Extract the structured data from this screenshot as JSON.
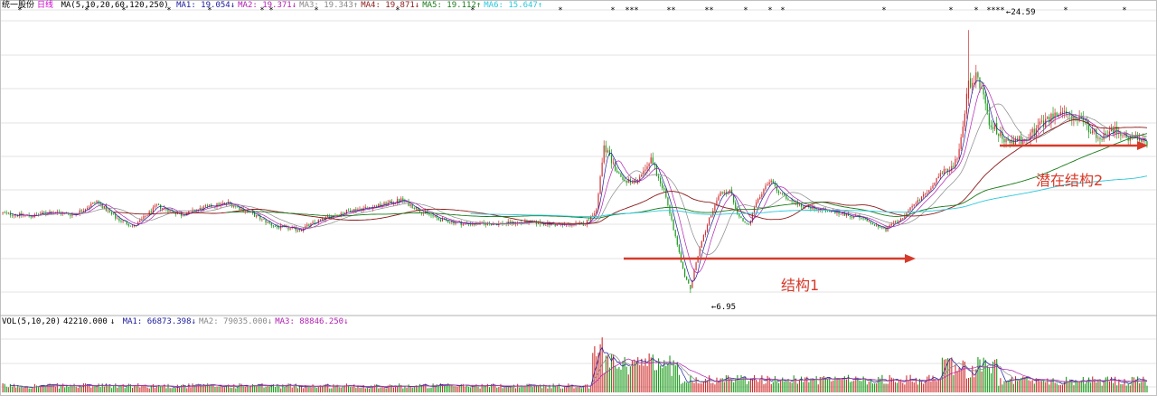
{
  "price_header": {
    "stock_name": "统一股份",
    "period": "日线",
    "ma_label": "MA(5,10,20,60,120,250)",
    "ma_values": [
      {
        "label": "MA1:",
        "value": "19.054",
        "arrow": "↓",
        "color": "#1a1a9c"
      },
      {
        "label": "MA2:",
        "value": "19.371",
        "arrow": "↓",
        "color": "#b020b0"
      },
      {
        "label": "MA3:",
        "value": "19.343",
        "arrow": "↑",
        "color": "#888888"
      },
      {
        "label": "MA4:",
        "value": "19.871",
        "arrow": "↓",
        "color": "#8b1a1a"
      },
      {
        "label": "MA5:",
        "value": "19.112",
        "arrow": "↑",
        "color": "#1a7a1a"
      },
      {
        "label": "MA6:",
        "value": "15.647",
        "arrow": "↑",
        "color": "#2ac8dc"
      }
    ]
  },
  "volume_header": {
    "vol_label": "VOL(5,10,20)",
    "vol_value": "42210.000",
    "vol_arrow": "↓",
    "ma_values": [
      {
        "label": "MA1:",
        "value": "66873.398",
        "arrow": "↓",
        "color": "#1a1a9c"
      },
      {
        "label": "MA2:",
        "value": "79035.000",
        "arrow": "↓",
        "color": "#888888"
      },
      {
        "label": "MA3:",
        "value": "88846.250",
        "arrow": "↓",
        "color": "#b020b0"
      }
    ]
  },
  "annotations": {
    "high_label": "24.59",
    "low_label": "6.95",
    "structure1": "结构1",
    "structure2": "潜在结构2"
  },
  "colors": {
    "up": "#d03030",
    "down": "#1a9a1a",
    "arrow": "#d63a2a",
    "grid": "#e3e3e3",
    "ma1": "#1a1a9c",
    "ma2": "#b020b0",
    "ma3": "#888888",
    "ma4": "#8b1a1a",
    "ma5": "#1a7a1a",
    "ma6": "#2ac8dc"
  },
  "chart_data": {
    "type": "candlestick",
    "ylim": [
      5.5,
      26.0
    ],
    "high": 24.59,
    "low": 6.95,
    "price_path_keypoints": [
      [
        0,
        12.3
      ],
      [
        15,
        12.1
      ],
      [
        25,
        12.4
      ],
      [
        38,
        12.2
      ],
      [
        50,
        13.1
      ],
      [
        60,
        12.0
      ],
      [
        70,
        11.4
      ],
      [
        82,
        12.8
      ],
      [
        95,
        12.2
      ],
      [
        108,
        12.7
      ],
      [
        120,
        13.0
      ],
      [
        132,
        12.3
      ],
      [
        145,
        11.4
      ],
      [
        158,
        11.2
      ],
      [
        170,
        11.9
      ],
      [
        185,
        12.5
      ],
      [
        200,
        12.8
      ],
      [
        212,
        13.2
      ],
      [
        222,
        12.5
      ],
      [
        232,
        11.9
      ],
      [
        245,
        11.6
      ],
      [
        262,
        11.6
      ],
      [
        280,
        11.7
      ],
      [
        298,
        11.5
      ],
      [
        310,
        11.6
      ],
      [
        316,
        12.6
      ],
      [
        320,
        17.0
      ],
      [
        323,
        16.0
      ],
      [
        330,
        14.5
      ],
      [
        338,
        14.4
      ],
      [
        345,
        16.0
      ],
      [
        352,
        13.8
      ],
      [
        358,
        10.8
      ],
      [
        363,
        8.0
      ],
      [
        366,
        7.3
      ],
      [
        370,
        9.5
      ],
      [
        376,
        12.0
      ],
      [
        382,
        13.6
      ],
      [
        387,
        13.8
      ],
      [
        392,
        12.0
      ],
      [
        397,
        11.5
      ],
      [
        402,
        13.3
      ],
      [
        408,
        14.5
      ],
      [
        415,
        13.5
      ],
      [
        425,
        12.8
      ],
      [
        438,
        12.5
      ],
      [
        450,
        12.2
      ],
      [
        460,
        11.8
      ],
      [
        470,
        11.2
      ],
      [
        480,
        12.2
      ],
      [
        490,
        13.5
      ],
      [
        500,
        15.0
      ],
      [
        508,
        15.8
      ],
      [
        514,
        21.0
      ],
      [
        519,
        21.5
      ],
      [
        525,
        18.5
      ],
      [
        535,
        17.0
      ],
      [
        545,
        17.3
      ],
      [
        555,
        18.5
      ],
      [
        562,
        19.0
      ],
      [
        570,
        18.8
      ],
      [
        578,
        18.0
      ],
      [
        585,
        17.3
      ],
      [
        592,
        18.0
      ],
      [
        600,
        17.2
      ],
      [
        610,
        17.0
      ]
    ],
    "volume_level": "low before the breakout, spike to the highest volume at the start of the rally, elevated afterwards",
    "series": [
      {
        "name": "MA1",
        "period": 5
      },
      {
        "name": "MA2",
        "period": 10
      },
      {
        "name": "MA3",
        "period": 20
      },
      {
        "name": "MA4",
        "period": 60
      },
      {
        "name": "MA5",
        "period": 120
      },
      {
        "name": "MA6",
        "period": 250
      }
    ]
  }
}
